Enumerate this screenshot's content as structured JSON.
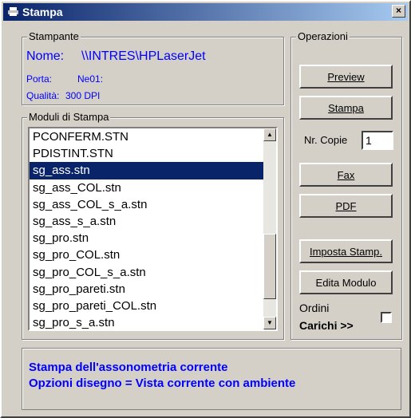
{
  "window": {
    "title": "Stampa",
    "close_label": "×"
  },
  "stampante": {
    "legend": "Stampante",
    "nome_label": "Nome:",
    "nome_value": "\\\\INTRES\\HPLaserJet",
    "porta_label": "Porta:",
    "porta_value": "Ne01:",
    "qualita_label": "Qualità:",
    "qualita_value": "300 DPI"
  },
  "moduli": {
    "legend": "Moduli di Stampa",
    "items": [
      "PCONFERM.STN",
      "PDISTINT.STN",
      "sg_ass.stn",
      "sg_ass_COL.stn",
      "sg_ass_COL_s_a.stn",
      "sg_ass_s_a.stn",
      "sg_pro.stn",
      "sg_pro_COL.stn",
      "sg_pro_COL_s_a.stn",
      "sg_pro_pareti.stn",
      "sg_pro_pareti_COL.stn",
      "sg_pro_s_a.stn"
    ],
    "selected_index": 2
  },
  "operazioni": {
    "legend": "Operazioni",
    "preview": "Preview",
    "stampa": "Stampa",
    "copie_label": "Nr. Copie",
    "copie_value": "1",
    "fax": "Fax",
    "pdf": "PDF",
    "imposta": "Imposta Stamp.",
    "edita": "Edita Modulo",
    "ordini_label": "Ordini",
    "carichi_label": "Carichi >>",
    "ordini_checked": false
  },
  "status": {
    "line1": "Stampa dell'assonometria corrente",
    "line2": "Opzioni disegno = Vista corrente con ambiente"
  }
}
